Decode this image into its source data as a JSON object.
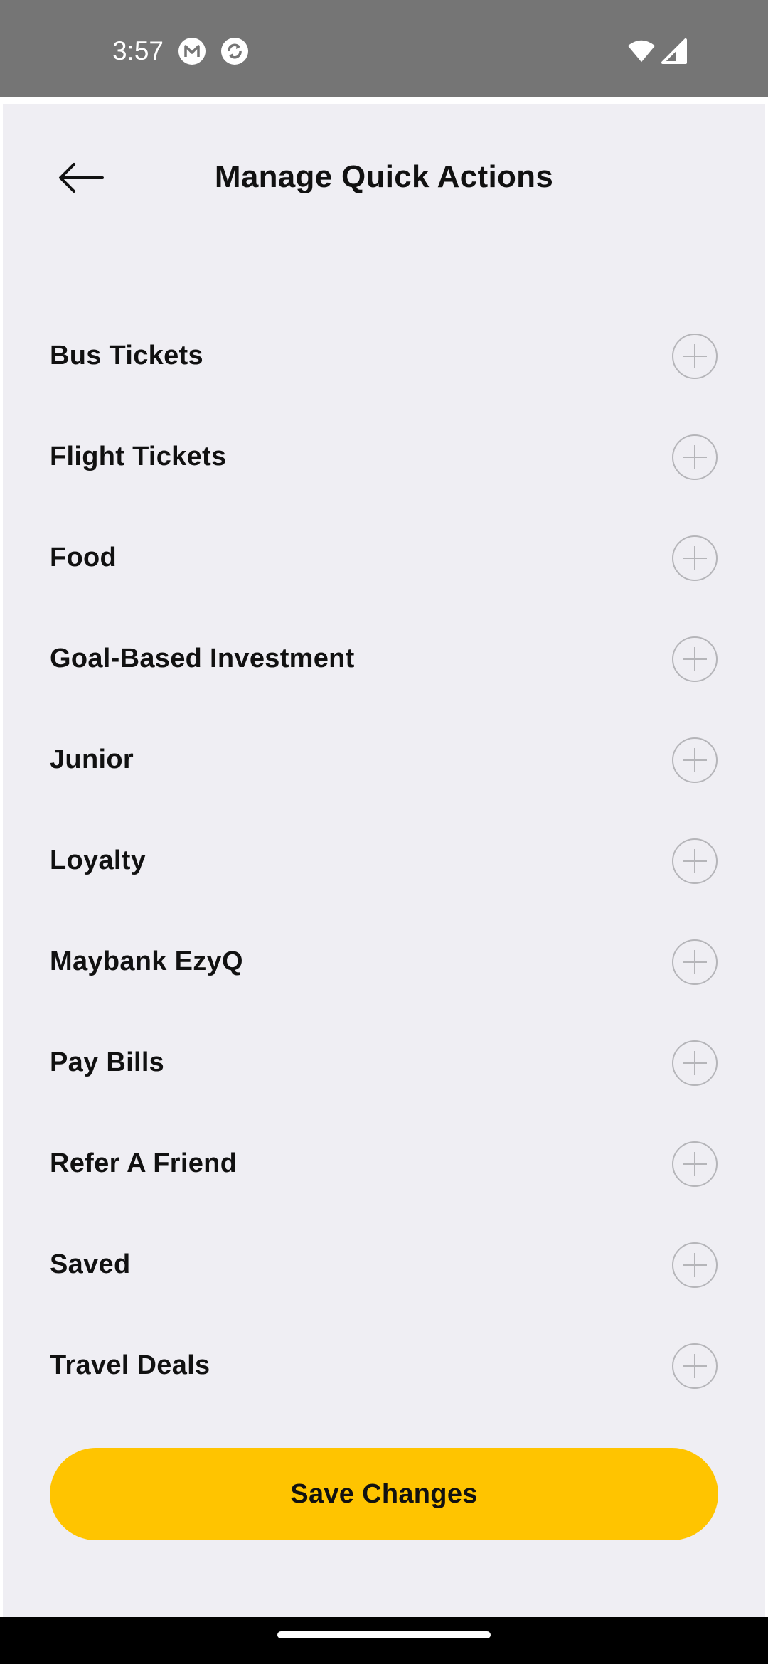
{
  "status_bar": {
    "time": "3:57",
    "icons": [
      "m-logo-icon",
      "sync-app-icon",
      "wifi-icon",
      "cellular-signal-icon"
    ]
  },
  "header": {
    "back_icon": "arrow-left-icon",
    "title": "Manage Quick Actions"
  },
  "items": [
    {
      "label": "Bus Tickets",
      "action_icon": "plus-circle-icon"
    },
    {
      "label": "Flight Tickets",
      "action_icon": "plus-circle-icon"
    },
    {
      "label": "Food",
      "action_icon": "plus-circle-icon"
    },
    {
      "label": "Goal-Based Investment",
      "action_icon": "plus-circle-icon"
    },
    {
      "label": "Junior",
      "action_icon": "plus-circle-icon"
    },
    {
      "label": "Loyalty",
      "action_icon": "plus-circle-icon"
    },
    {
      "label": "Maybank EzyQ",
      "action_icon": "plus-circle-icon"
    },
    {
      "label": "Pay Bills",
      "action_icon": "plus-circle-icon"
    },
    {
      "label": "Refer A Friend",
      "action_icon": "plus-circle-icon"
    },
    {
      "label": "Saved",
      "action_icon": "plus-circle-icon"
    },
    {
      "label": "Travel Deals",
      "action_icon": "plus-circle-icon"
    }
  ],
  "footer": {
    "save_label": "Save Changes"
  },
  "colors": {
    "accent": "#ffc400",
    "background": "#efeef3",
    "status_bar": "#757575",
    "icon_stroke": "#b5b5b9"
  }
}
